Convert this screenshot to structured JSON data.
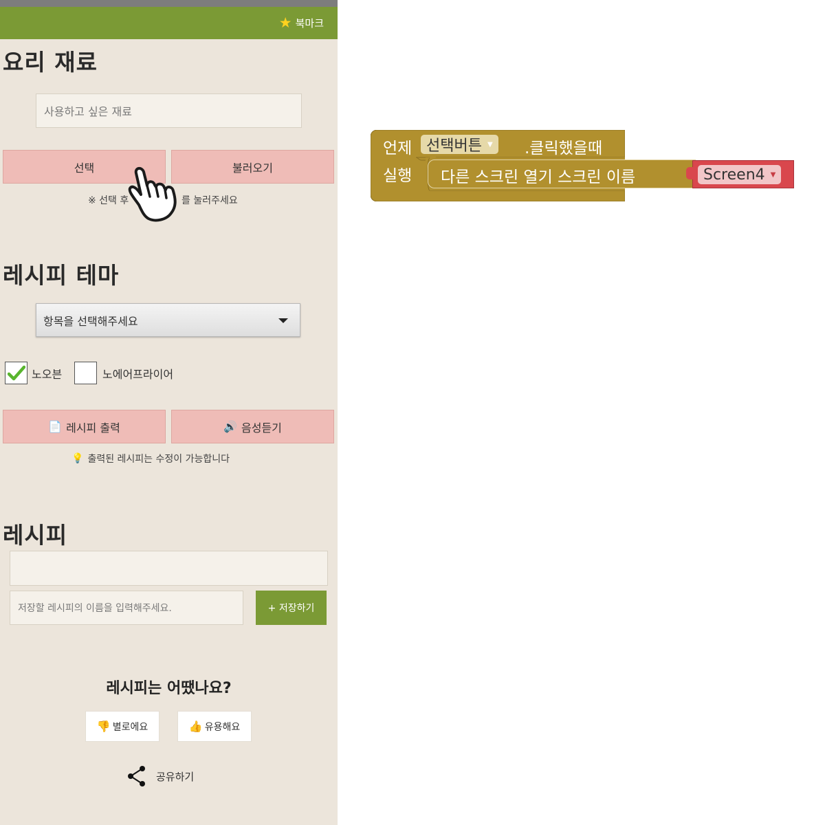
{
  "app": {
    "bookmark_label": "북마크"
  },
  "ingredients": {
    "title": "요리 재료",
    "input_placeholder": "사용하고 싶은 재료",
    "select_button": "선택",
    "load_button": "불러오기",
    "note_left": "※ 선택 후",
    "note_right": "를 눌러주세요"
  },
  "theme": {
    "title": "레시피 테마",
    "select_value": "항목을 선택해주세요",
    "checkboxes": [
      {
        "label": "노오븐",
        "checked": true
      },
      {
        "label": "노에어프라이어",
        "checked": false
      }
    ],
    "print_button": "레시피 출력",
    "print_icon": "document-icon",
    "listen_button": "음성듣기",
    "listen_icon": "speaker-icon",
    "note": "출력된 레시피는 수정이 가능합니다",
    "note_icon": "lightbulb-icon"
  },
  "recipe": {
    "title": "레시피",
    "recipe_value": "",
    "name_placeholder": "저장할 레시피의 이름을 입력해주세요.",
    "save_button": "+ 저장하기"
  },
  "rating": {
    "title": "레시피는 어땠나요?",
    "bad_button": "별로에요",
    "good_button": "유용해요"
  },
  "share": {
    "label": "공유하기"
  },
  "blocks": {
    "when_label": "언제",
    "button_component": "선택버튼",
    "event_label": ".클릭했을때",
    "do_label": "실행",
    "open_screen_label": "다른 스크린 열기  스크린 이름",
    "screen_value": "Screen4",
    "colors": {
      "event_block": "#b1902e",
      "screen_block": "#d9474d",
      "app_bar": "#7b9a35",
      "button_pink": "#efbcb7"
    }
  }
}
